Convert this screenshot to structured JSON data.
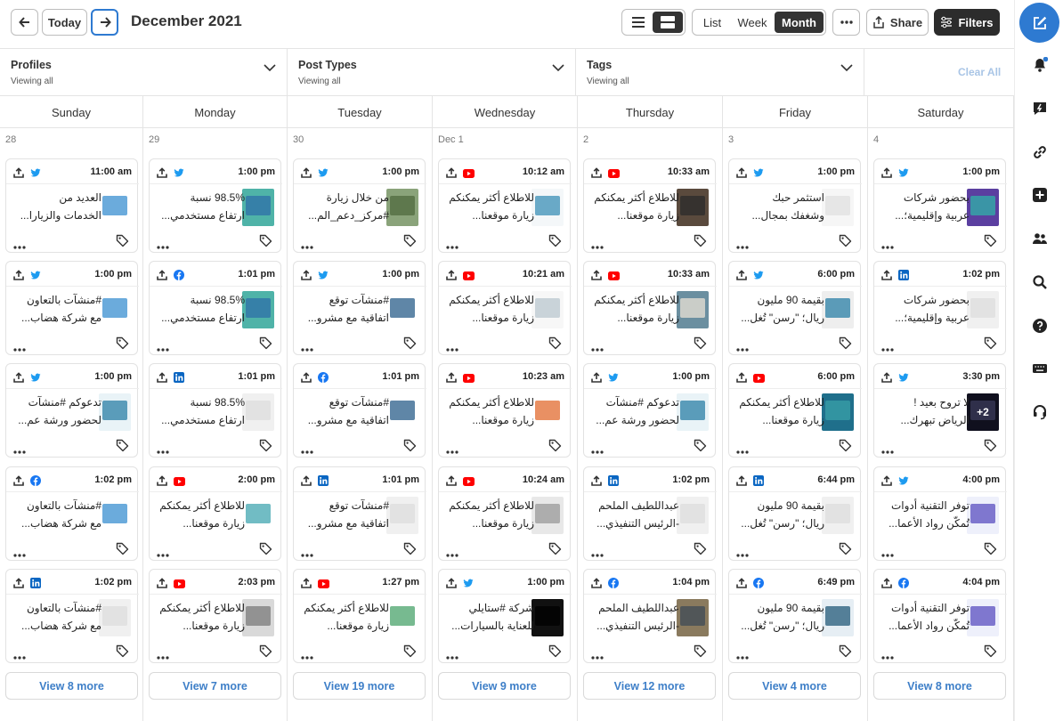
{
  "toolbar": {
    "today_label": "Today",
    "title": "December 2021",
    "view_list": "List",
    "view_week": "Week",
    "view_month": "Month",
    "share_label": "Share",
    "filters_label": "Filters"
  },
  "filters": {
    "profiles_label": "Profiles",
    "profiles_value": "Viewing all",
    "types_label": "Post Types",
    "types_value": "Viewing all",
    "tags_label": "Tags",
    "tags_value": "Viewing all",
    "clear_label": "Clear All"
  },
  "days": [
    {
      "name": "Sunday",
      "date": "28",
      "more": "View 8 more",
      "posts": [
        {
          "net": "twitter",
          "time": "11:00 am",
          "l1": "العديد من",
          "l2": "الخدمات والزيارا...",
          "th": "#ffffff",
          "tb": "#3a8fd0"
        },
        {
          "net": "twitter",
          "time": "1:00 pm",
          "l1": "#منشآت بالتعاون",
          "l2": "مع شركة هضاب...",
          "th": "#ffffff",
          "tb": "#3a8fd0"
        },
        {
          "net": "twitter",
          "time": "1:00 pm",
          "l1": "تدعوكم #منشآت",
          "l2": "لحضور ورشة عم...",
          "th": "#e9f3f7",
          "tb": "#2a7fa6"
        },
        {
          "net": "facebook",
          "time": "1:02 pm",
          "l1": "#منشآت بالتعاون",
          "l2": "مع شركة هضاب...",
          "th": "#ffffff",
          "tb": "#3a8fd0"
        },
        {
          "net": "linkedin",
          "time": "1:02 pm",
          "l1": "#منشآت بالتعاون",
          "l2": "مع شركة هضاب...",
          "th": "#f0f0f0",
          "tb": "#dddddd"
        }
      ]
    },
    {
      "name": "Monday",
      "date": "29",
      "more": "View 7 more",
      "posts": [
        {
          "net": "twitter",
          "time": "1:00 pm",
          "l1": "98.5% نسبة",
          "l2": "ارتفاع مستخدمي...",
          "th": "#4fb3a8",
          "tb": "#2d6fa8"
        },
        {
          "net": "facebook",
          "time": "1:01 pm",
          "l1": "98.5% نسبة",
          "l2": "ارتفاع مستخدمي...",
          "th": "#4fb3a8",
          "tb": "#2d6fa8"
        },
        {
          "net": "linkedin",
          "time": "1:01 pm",
          "l1": "98.5% نسبة",
          "l2": "ارتفاع مستخدمي...",
          "th": "#f0f0f0",
          "tb": "#dddddd"
        },
        {
          "net": "youtube",
          "time": "2:00 pm",
          "l1": "للاطلاع أكثر يمكنكم",
          "l2": "زيارة موقعنا...",
          "th": "#ffffff",
          "tb": "#42a6b0"
        },
        {
          "net": "youtube",
          "time": "2:03 pm",
          "l1": "للاطلاع أكثر يمكنكم",
          "l2": "زيارة موقعنا...",
          "th": "#d9d9d9",
          "tb": "#7a7a7a"
        }
      ]
    },
    {
      "name": "Tuesday",
      "date": "30",
      "more": "View 19 more",
      "posts": [
        {
          "net": "twitter",
          "time": "1:00 pm",
          "l1": "من خلال زيارة",
          "l2": "#مركز_دعم_الم...",
          "th": "#8aa37a",
          "tb": "#4f6a3f"
        },
        {
          "net": "twitter",
          "time": "1:00 pm",
          "l1": "#منشآت توقع",
          "l2": "اتفاقية مع مشرو...",
          "th": "#ffffff",
          "tb": "#2a5d8a"
        },
        {
          "net": "facebook",
          "time": "1:01 pm",
          "l1": "#منشآت توقع",
          "l2": "اتفاقية مع مشرو...",
          "th": "#ffffff",
          "tb": "#2a5d8a"
        },
        {
          "net": "linkedin",
          "time": "1:01 pm",
          "l1": "#منشآت توقع",
          "l2": "اتفاقية مع مشرو...",
          "th": "#f0f0f0",
          "tb": "#dddddd"
        },
        {
          "net": "youtube",
          "time": "1:27 pm",
          "l1": "للاطلاع أكثر يمكنكم",
          "l2": "زيارة موقعنا...",
          "th": "#ffffff",
          "tb": "#4aa36b"
        }
      ]
    },
    {
      "name": "Wednesday",
      "date": "Dec 1",
      "more": "View 9 more",
      "posts": [
        {
          "net": "youtube",
          "time": "10:12 am",
          "l1": "للاطلاع أكثر يمكنكم",
          "l2": "زيارة موقعنا...",
          "th": "#f4f7f9",
          "tb": "#3b8fb5"
        },
        {
          "net": "youtube",
          "time": "10:21 am",
          "l1": "للاطلاع أكثر يمكنكم",
          "l2": "زيارة موقعنا...",
          "th": "#f7f7f7",
          "tb": "#b9c7cf"
        },
        {
          "net": "youtube",
          "time": "10:23 am",
          "l1": "للاطلاع أكثر يمكنكم",
          "l2": "زيارة موقعنا...",
          "th": "#ffffff",
          "tb": "#e26b2f"
        },
        {
          "net": "youtube",
          "time": "10:24 am",
          "l1": "للاطلاع أكثر يمكنكم",
          "l2": "زيارة موقعنا...",
          "th": "#e8e8e8",
          "tb": "#9a9a9a"
        },
        {
          "net": "twitter",
          "time": "1:00 pm",
          "l1": "شركة #ستايلي",
          "l2": "للعناية بالسيارات...",
          "th": "#111111",
          "tb": "#000000"
        }
      ]
    },
    {
      "name": "Thursday",
      "date": "2",
      "more": "View 12 more",
      "posts": [
        {
          "net": "youtube",
          "time": "10:33 am",
          "l1": "للاطلاع أكثر يمكنكم",
          "l2": "زيارة موقعنا...",
          "th": "#5a4a3d",
          "tb": "#2b2b2b"
        },
        {
          "net": "youtube",
          "time": "10:33 am",
          "l1": "للاطلاع أكثر يمكنكم",
          "l2": "زيارة موقعنا...",
          "th": "#6b8fa0",
          "tb": "#e9e2d6"
        },
        {
          "net": "twitter",
          "time": "1:00 pm",
          "l1": "تدعوكم #منشآت",
          "l2": "لحضور ورشة عم...",
          "th": "#e9f3f7",
          "tb": "#2a7fa6"
        },
        {
          "net": "linkedin",
          "time": "1:02 pm",
          "l1": "عبداللطيف الملحم",
          "l2": "-الرئيس التنفيذي...",
          "th": "#f0f0f0",
          "tb": "#dddddd"
        },
        {
          "net": "facebook",
          "time": "1:04 pm",
          "l1": "عبداللطيف الملحم",
          "l2": "-الرئيس التنفيذي...",
          "th": "#8a7a5e",
          "tb": "#3d4b57"
        }
      ]
    },
    {
      "name": "Friday",
      "date": "3",
      "more": "View 4 more",
      "posts": [
        {
          "net": "twitter",
          "time": "1:00 pm",
          "l1": "استثمر حبك",
          "l2": "وشغفك بمجال...",
          "th": "#f6f6f6",
          "tb": "#e0e0e0"
        },
        {
          "net": "twitter",
          "time": "6:00 pm",
          "l1": "بقيمة 90 مليون",
          "l2": "ريال؛ \"رسن\" تُغل...",
          "th": "#eeeeee",
          "tb": "#2a7fa6"
        },
        {
          "net": "youtube",
          "time": "6:00 pm",
          "l1": "للاطلاع أكثر يمكنكم",
          "l2": "زيارة موقعنا...",
          "th": "#1f6f8b",
          "tb": "#3aa0a8"
        },
        {
          "net": "linkedin",
          "time": "6:44 pm",
          "l1": "بقيمة 90 مليون",
          "l2": "ريال؛ \"رسن\" تُغل...",
          "th": "#f0f0f0",
          "tb": "#dddddd"
        },
        {
          "net": "facebook",
          "time": "6:49 pm",
          "l1": "بقيمة 90 مليون",
          "l2": "ريال؛ \"رسن\" تُغل...",
          "th": "#e6eef4",
          "tb": "#235a7a"
        }
      ]
    },
    {
      "name": "Saturday",
      "date": "4",
      "more": "View 8 more",
      "posts": [
        {
          "net": "twitter",
          "time": "1:00 pm",
          "l1": "بحضور شركات",
          "l2": "عربية وإقليمية؛...",
          "th": "#5b3fa0",
          "tb": "#2fb3a8"
        },
        {
          "net": "linkedin",
          "time": "1:02 pm",
          "l1": "بحضور شركات",
          "l2": "عربية وإقليمية؛...",
          "th": "#f0f0f0",
          "tb": "#dddddd"
        },
        {
          "net": "twitter",
          "time": "3:30 pm",
          "l1": "لا تروح بعيد !",
          "l2": "الرياض تبهرك...",
          "th": "#1a1a2e",
          "tb": "#5a5a8a",
          "badge": "+2"
        },
        {
          "net": "twitter",
          "time": "4:00 pm",
          "l1": "توفر التقنية أدوات",
          "l2": "تُمكّن رواد الأعما...",
          "th": "#eef0fb",
          "tb": "#5a4fc0"
        },
        {
          "net": "facebook",
          "time": "4:04 pm",
          "l1": "توفر التقنية أدوات",
          "l2": "تُمكّن رواد الأعما...",
          "th": "#eef0fb",
          "tb": "#5a4fc0"
        }
      ]
    }
  ],
  "colors": {
    "twitter": "#1d9bf0",
    "facebook": "#1877f2",
    "linkedin": "#0a66c2",
    "youtube": "#ff0000",
    "accent": "#2e7ad1"
  }
}
